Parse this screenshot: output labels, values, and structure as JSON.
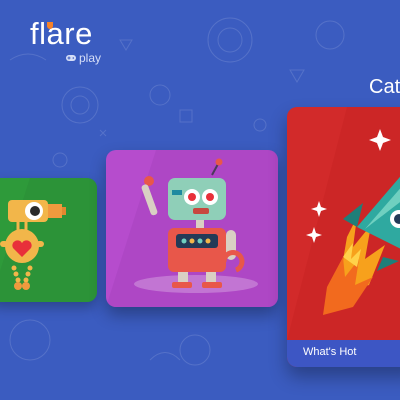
{
  "logo": {
    "brand": "flare",
    "sub": "play"
  },
  "category": {
    "heading_partial": "Cat"
  },
  "tiles": [
    {
      "id": "robot-green",
      "label": "",
      "background": "#2e9a3a"
    },
    {
      "id": "robot-purple",
      "label": "",
      "background": "#b64ccd",
      "focused": true
    },
    {
      "id": "rocket-red",
      "label": "What's Hot",
      "background": "#d22a2a"
    }
  ],
  "colors": {
    "background": "#3b5cc0",
    "label_bar": "#3d56c4",
    "logo_accent": "#f5822a"
  }
}
